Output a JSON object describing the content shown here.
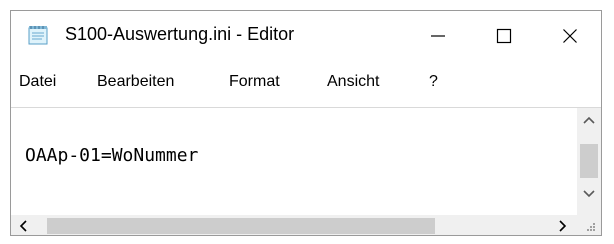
{
  "window": {
    "title": "S100-Auswertung.ini - Editor",
    "icon": "notepad-icon"
  },
  "controls": {
    "minimize_icon": "minimize-icon",
    "maximize_icon": "maximize-icon",
    "close_icon": "close-icon"
  },
  "menu": {
    "items": [
      "Datei",
      "Bearbeiten",
      "Format",
      "Ansicht",
      "?"
    ]
  },
  "editor": {
    "content": "OAAp-01=WoNummer"
  },
  "scrollbars": {
    "up_icon": "chevron-up-icon",
    "down_icon": "chevron-down-icon",
    "left_icon": "chevron-left-icon",
    "right_icon": "chevron-right-icon",
    "grip_icon": "resize-grip-icon"
  }
}
